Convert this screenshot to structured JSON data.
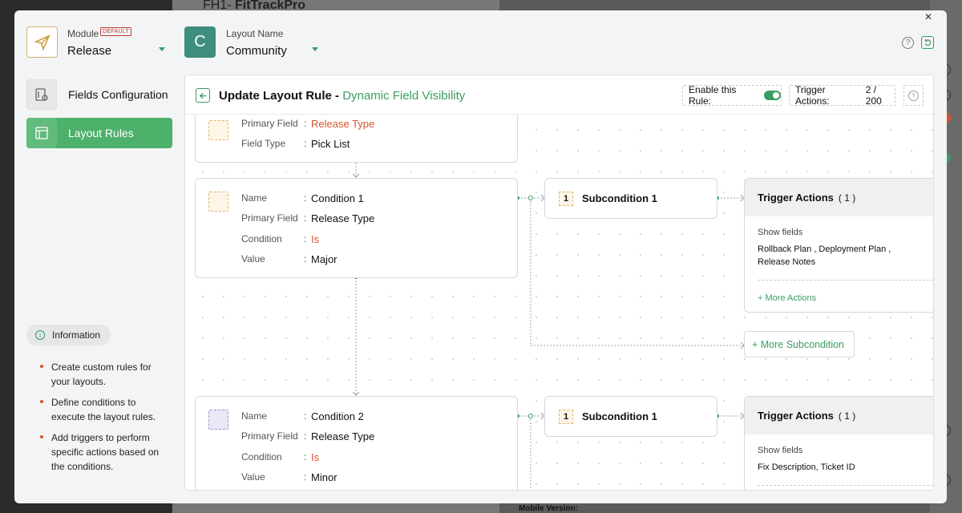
{
  "background": {
    "project_prefix": "FH1-",
    "project_name": "FitTrackPro",
    "bottom_text": "Mobile Version:"
  },
  "module": {
    "label": "Module",
    "badge": "DEFAULT",
    "value": "Release"
  },
  "layout": {
    "label": "Layout Name",
    "icon_letter": "C",
    "value": "Community"
  },
  "nav": {
    "fields": "Fields Configuration",
    "rules": "Layout Rules"
  },
  "info": {
    "title": "Information",
    "tips": [
      "Create custom rules for your layouts.",
      "Define conditions to execute the layout rules.",
      "Add triggers to perform specific actions based on the conditions."
    ]
  },
  "panel": {
    "title": "Update Layout Rule - ",
    "title_accent": "Dynamic Field Visibility",
    "enable_label": "Enable this Rule:",
    "trigger_label": "Trigger Actions:",
    "trigger_value": "2 / 200"
  },
  "primary": {
    "primary_field_label": "Primary Field",
    "primary_field_value": "Release Type",
    "field_type_label": "Field Type",
    "field_type_value": "Pick List"
  },
  "conditions": [
    {
      "name_label": "Name",
      "name": "Condition 1",
      "primary_field_label": "Primary Field",
      "primary_field": "Release Type",
      "condition_label": "Condition",
      "condition": "Is",
      "value_label": "Value",
      "value": "Major",
      "subcondition_num": "1",
      "subcondition": "Subcondition 1",
      "trigger_title": "Trigger Actions",
      "trigger_count": "( 1 )",
      "show_fields_label": "Show fields",
      "fields": "Rollback Plan , Deployment Plan , Release Notes",
      "more_actions": "+ More Actions"
    },
    {
      "name_label": "Name",
      "name": "Condition 2",
      "primary_field_label": "Primary Field",
      "primary_field": "Release Type",
      "condition_label": "Condition",
      "condition": "Is",
      "value_label": "Value",
      "value": "Minor",
      "subcondition_num": "1",
      "subcondition": "Subcondition 1",
      "trigger_title": "Trigger Actions",
      "trigger_count": "( 1 )",
      "show_fields_label": "Show fields",
      "fields": "Fix Description, Ticket ID"
    }
  ],
  "more_subcondition": "+ More Subcondition",
  "colors": {
    "accent": "#3a9d63",
    "nav_active": "#4db06b",
    "warning": "#d9532c",
    "layout_icon": "#3e8e7e"
  }
}
